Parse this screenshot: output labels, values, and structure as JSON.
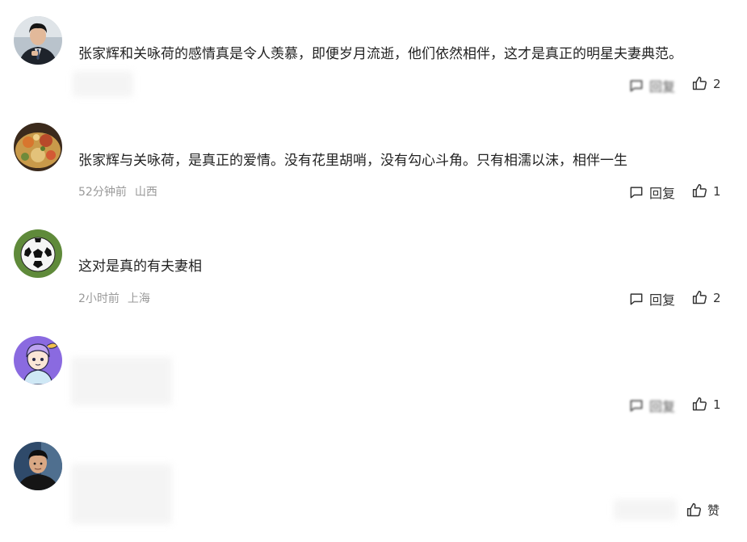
{
  "comments": [
    {
      "avatar": "man-in-suit-avatar",
      "text": "张家辉和关咏荷的感情真是令人羡慕，即便岁月流逝，他们依然相伴，这才是真正的明星夫妻典范。",
      "time": "",
      "location": "",
      "reply_label": "回复",
      "likes": "2"
    },
    {
      "avatar": "food-platter-avatar",
      "text": "张家辉与关咏荷，是真正的爱情。没有花里胡哨，没有勾心斗角。只有相濡以沫，相伴一生",
      "time": "52分钟前",
      "location": "山西",
      "reply_label": "回复",
      "likes": "1"
    },
    {
      "avatar": "soccer-ball-avatar",
      "text": "这对是真的有夫妻相",
      "time": "2小时前",
      "location": "上海",
      "reply_label": "回复",
      "likes": "2"
    },
    {
      "avatar": "cartoon-girl-avatar",
      "text": "",
      "time": "",
      "location": "",
      "reply_label": "回复",
      "likes": "1"
    },
    {
      "avatar": "man-portrait-avatar",
      "text": "",
      "time": "",
      "location": "",
      "reply_label": "",
      "likes": "赞"
    }
  ],
  "colors": {
    "text": "#222222",
    "meta": "#999999",
    "icon": "#333333"
  }
}
